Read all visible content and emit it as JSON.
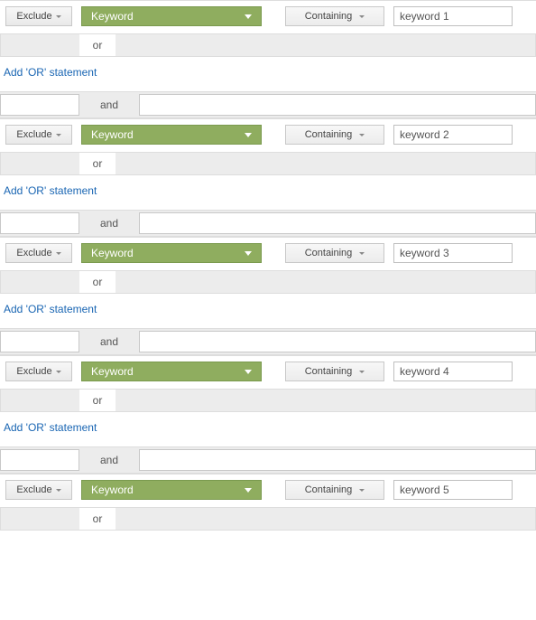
{
  "labels": {
    "exclude": "Exclude",
    "condition": "Containing",
    "or": "or",
    "and": "and",
    "add_or": "Add 'OR' statement"
  },
  "rules": [
    {
      "dimension": "Keyword",
      "value": "keyword 1",
      "show_add_or": true,
      "show_and": true
    },
    {
      "dimension": "Keyword",
      "value": "keyword 2",
      "show_add_or": true,
      "show_and": true
    },
    {
      "dimension": "Keyword",
      "value": "keyword 3",
      "show_add_or": true,
      "show_and": true
    },
    {
      "dimension": "Keyword",
      "value": "keyword 4",
      "show_add_or": true,
      "show_and": true
    },
    {
      "dimension": "Keyword",
      "value": "keyword 5",
      "show_add_or": false,
      "show_and": false
    }
  ]
}
